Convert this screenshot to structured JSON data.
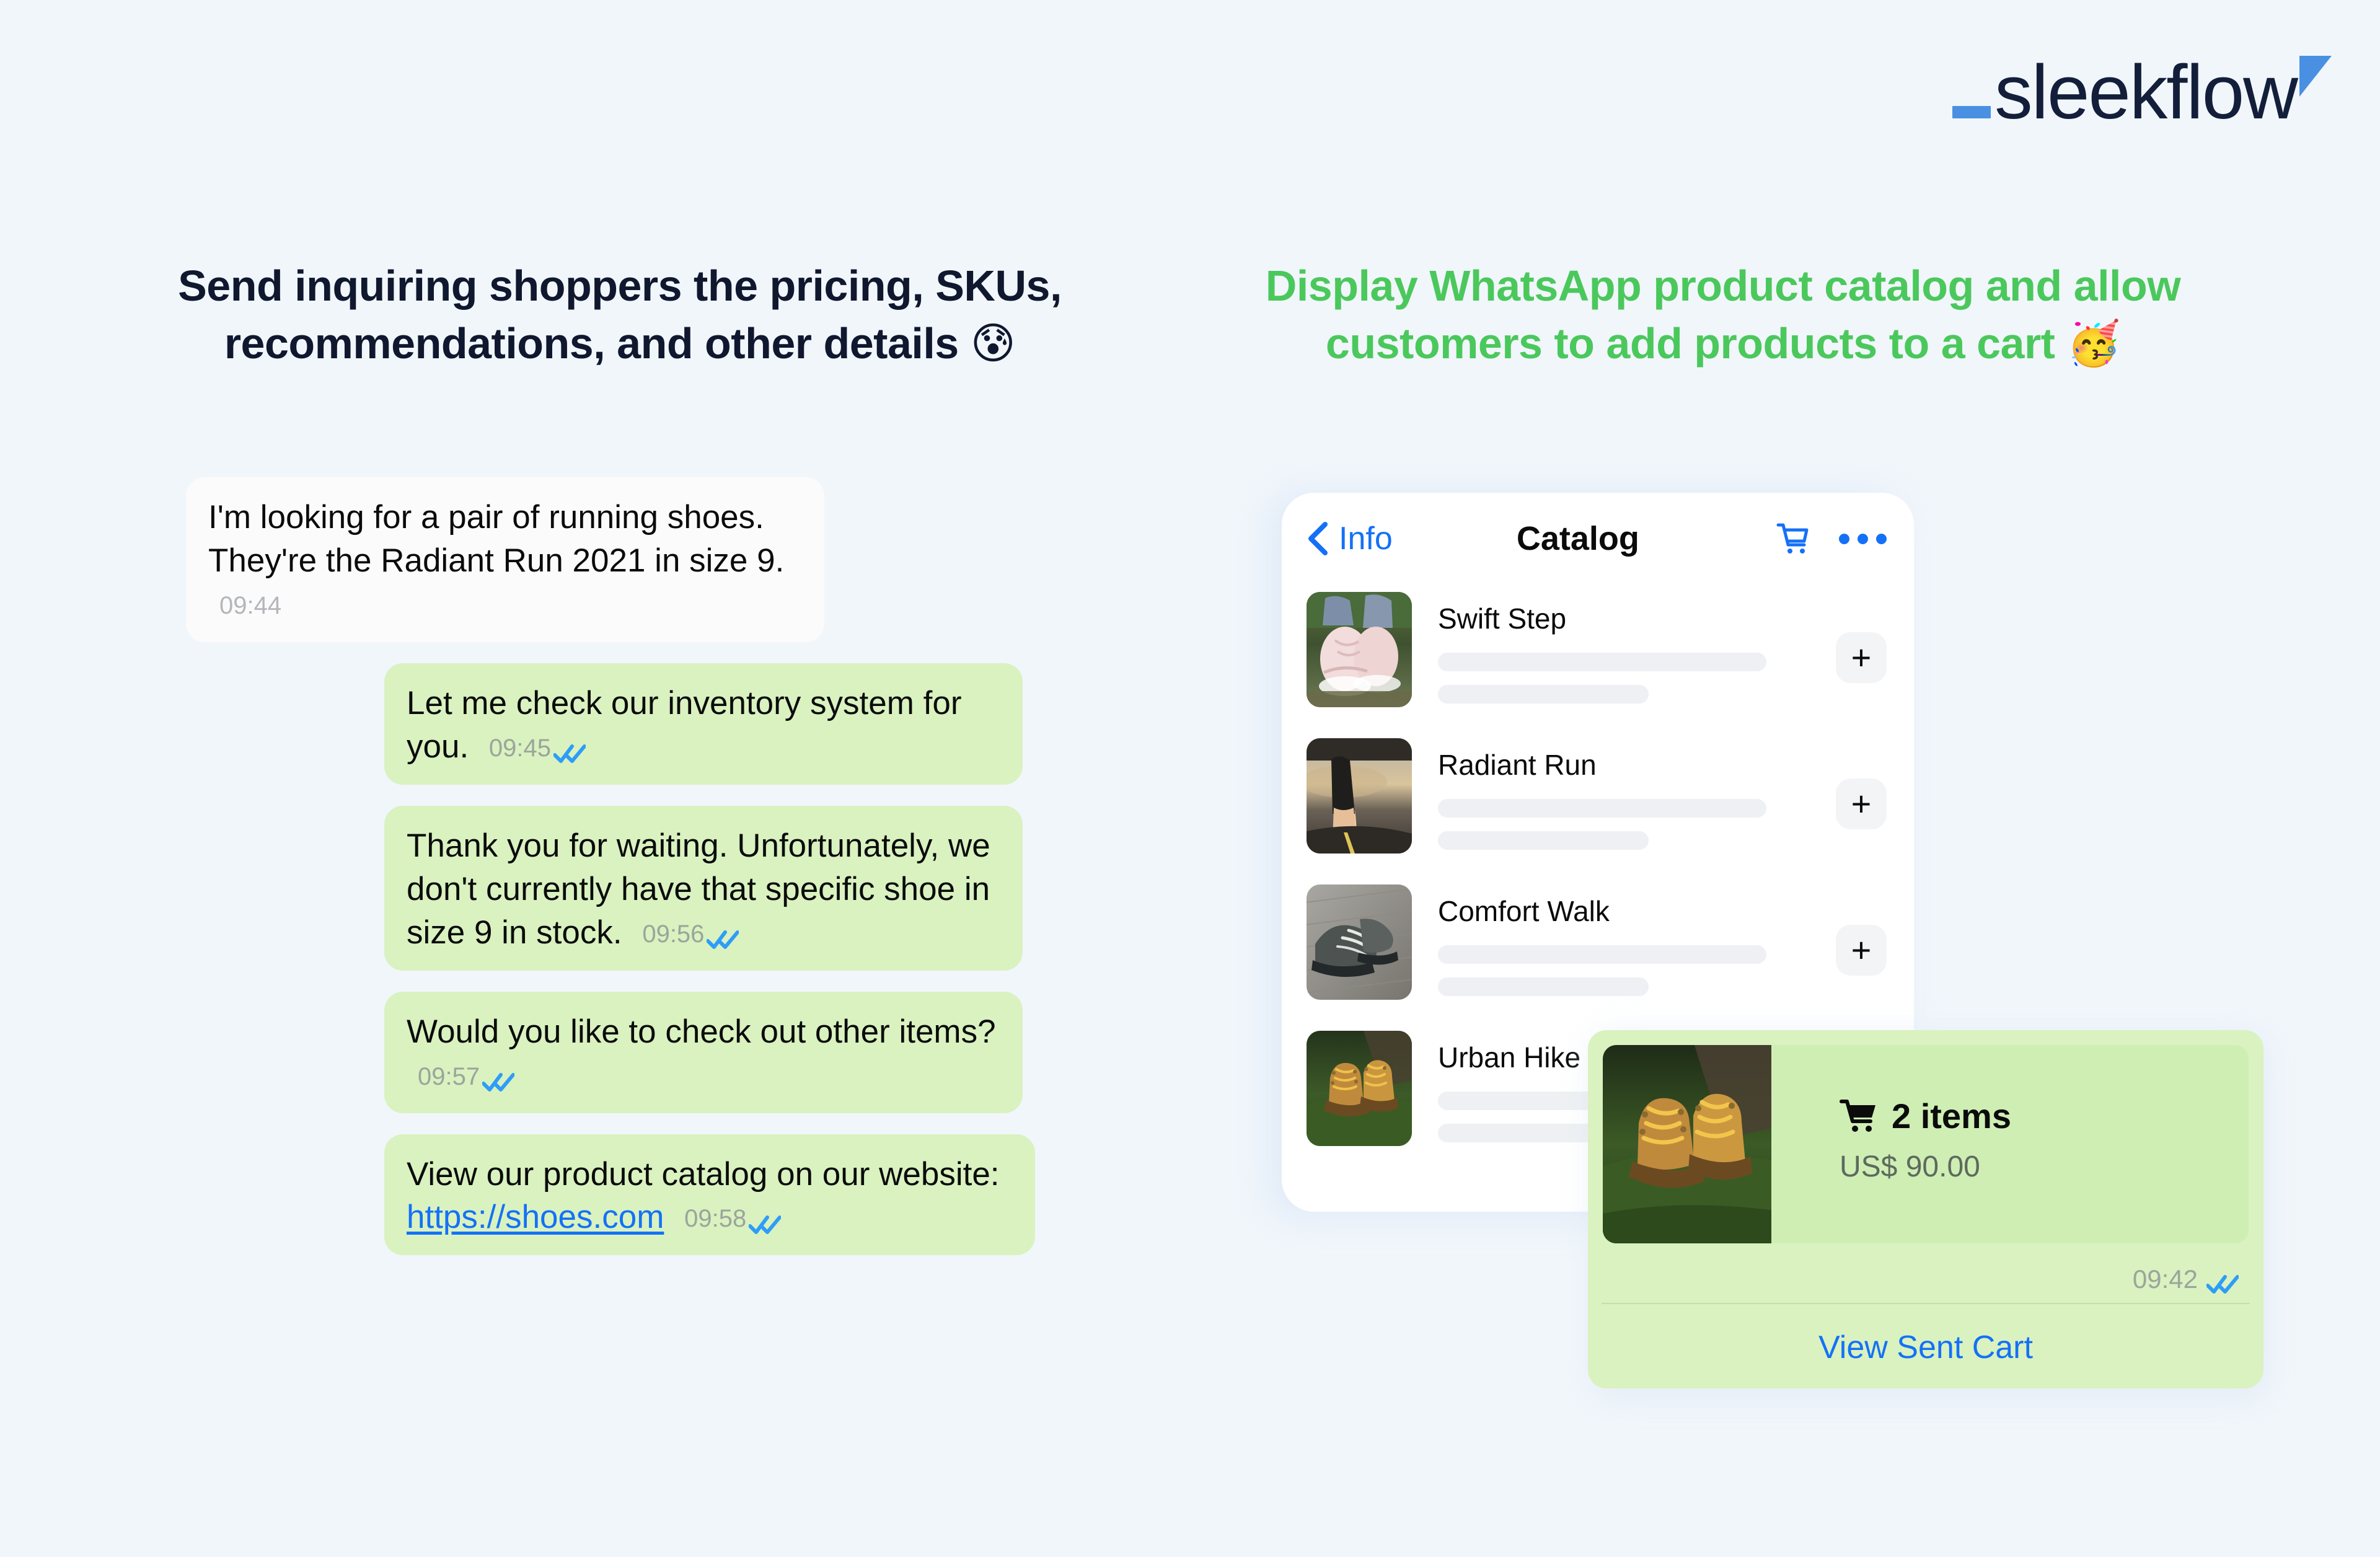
{
  "brand": {
    "logo_text": "sleekflow",
    "accent_color": "#4a90e2",
    "wordmark_color": "#131f3a"
  },
  "headings": {
    "left": "Send inquiring shoppers the pricing, SKUs, recommendations, and other details 😰",
    "right": "Display WhatsApp product catalog and allow customers to add products to a cart 🥳",
    "left_color": "#10182f",
    "right_color": "#4bc85c"
  },
  "chat": {
    "messages": [
      {
        "direction": "incoming",
        "text": "I'm looking for a pair of running shoes. They're the Radiant Run 2021 in size 9.",
        "time": "09:44",
        "read": false
      },
      {
        "direction": "outgoing",
        "text": "Let me check our inventory system for you.",
        "time": "09:45",
        "read": true
      },
      {
        "direction": "outgoing",
        "text": "Thank you for waiting. Unfortunately, we don't currently have that specific shoe in size 9 in stock.",
        "time": "09:56",
        "read": true
      },
      {
        "direction": "outgoing",
        "text": "Would you like to check out other items?",
        "time": "09:57",
        "read": true
      },
      {
        "direction": "outgoing",
        "text": "View our product catalog on our website: ",
        "link_text": "https://shoes.com",
        "time": "09:58",
        "read": true
      }
    ]
  },
  "catalog": {
    "back_label": "Info",
    "title": "Catalog",
    "back_icon": "chevron-left-icon",
    "cart_icon": "shopping-cart-icon",
    "more_icon": "more-horizontal-icon",
    "add_label": "+",
    "products": [
      {
        "name": "Swift Step",
        "thumb": "pink-sneakers-on-log-photo"
      },
      {
        "name": "Radiant Run",
        "thumb": "runner-on-road-photo"
      },
      {
        "name": "Comfort Walk",
        "thumb": "grey-trail-shoes-photo"
      },
      {
        "name": "Urban Hike",
        "thumb": "tan-hiking-boots-photo"
      }
    ]
  },
  "cart_card": {
    "thumb": "tan-hiking-boots-photo",
    "cart_icon": "shopping-cart-icon",
    "items_label": "2 items",
    "price": "US$ 90.00",
    "time": "09:42",
    "read": true,
    "action_label": "View Sent Cart",
    "action_color": "#1471f7"
  }
}
